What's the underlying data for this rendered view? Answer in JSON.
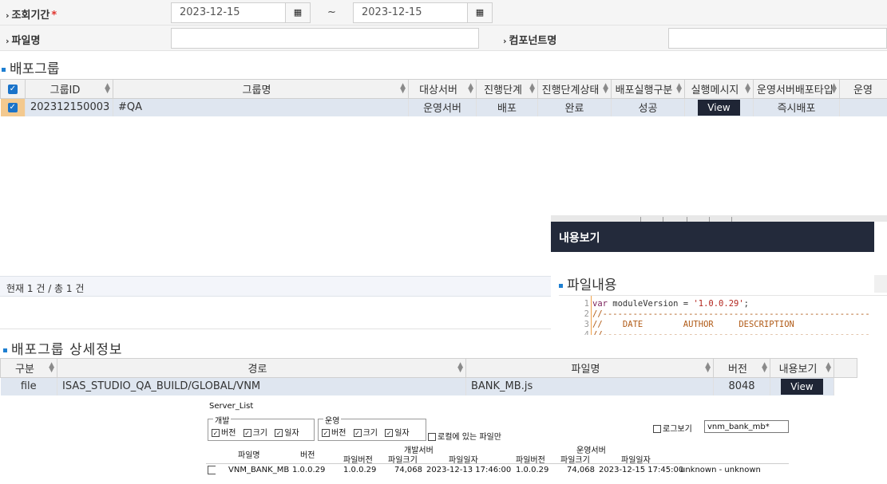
{
  "search": {
    "period_label": "조회기간",
    "required_mark": "*",
    "date_from": "2023-12-15",
    "date_to": "2023-12-15",
    "tilde": "~",
    "file_label": "파일명",
    "file_value": "",
    "component_label": "컴포넌트명",
    "component_value": ""
  },
  "deploy_group": {
    "title": "배포그룹",
    "columns": [
      "그룹ID",
      "그룹명",
      "대상서버",
      "진행단계",
      "진행단계상태",
      "배포실행구분",
      "실행메시지",
      "운영서버배포타입",
      "운영"
    ],
    "rows": [
      {
        "id": "202312150003",
        "name": "#QA",
        "target": "운영서버",
        "stage": "배포",
        "stage_status": "완료",
        "exec_type": "성공",
        "message_btn": "View",
        "deploy_type": "즉시배포",
        "extra": ""
      }
    ],
    "status_text": "현재 1 건 / 총 1 건"
  },
  "detail": {
    "title": "배포그룹 상세정보",
    "columns": [
      "구분",
      "경로",
      "파일명",
      "버전",
      "내용보기"
    ],
    "rows": [
      {
        "type": "file",
        "path": "ISAS_STUDIO_QA_BUILD/GLOBAL/VNM",
        "filename": "BANK_MB.js",
        "version": "8048",
        "view_btn": "View"
      }
    ]
  },
  "popup": {
    "title": "내용보기",
    "file_content_title": "파일내용",
    "code_lines": [
      {
        "no": "1",
        "text": "var moduleVersion = '1.0.0.29';"
      },
      {
        "no": "2",
        "text": "//-----------------------------------------------------"
      },
      {
        "no": "3",
        "text": "//    DATE        AUTHOR     DESCRIPTION"
      },
      {
        "no": "4",
        "text": "//-----------------------------------------------------"
      }
    ]
  },
  "server_list": {
    "title": "Server_List",
    "dev_group": "개발",
    "ops_group": "운영",
    "chk_version": "버전",
    "chk_size": "크기",
    "chk_date": "일자",
    "local_only": "로컬에 있는 파일만",
    "log_view": "로그보기",
    "log_input": "vnm_bank_mb*",
    "dev_server": "개발서버",
    "ops_server": "운영서버",
    "col_filename": "파일명",
    "col_version": "버전",
    "col_file_version": "파일버전",
    "col_file_size": "파일크기",
    "col_file_date": "파일일자",
    "row": {
      "filename": "VNM_BANK_MB",
      "version": "1.0.0.29",
      "dev_version": "1.0.0.29",
      "dev_size": "74,068",
      "dev_date": "2023-12-13 17:46:00",
      "ops_version": "1.0.0.29",
      "ops_size": "74,068",
      "ops_date": "2023-12-15 17:45:00",
      "note": "unknown - unknown"
    }
  }
}
